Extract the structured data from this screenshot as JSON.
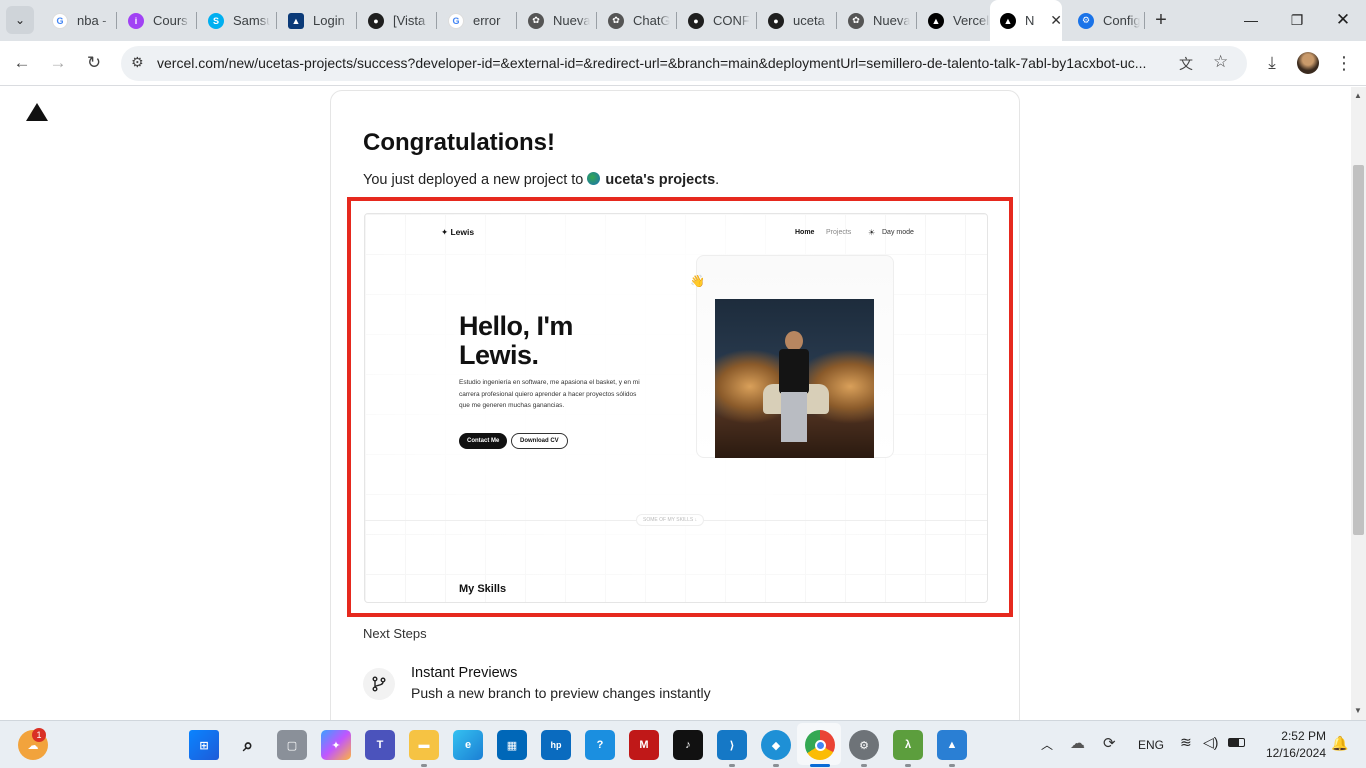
{
  "tabs": [
    {
      "title": "nba - ",
      "icon": "google-icon",
      "color": "#4285f4"
    },
    {
      "title": "Cours",
      "icon": "course-icon",
      "color": "#a142f4"
    },
    {
      "title": "Samsu",
      "icon": "skype-icon",
      "color": "#00aff0"
    },
    {
      "title": "Login",
      "icon": "atlassian-icon",
      "color": "#0b3a78"
    },
    {
      "title": "[Vista",
      "icon": "github-icon",
      "color": "#1f1f1f"
    },
    {
      "title": "error ",
      "icon": "google-icon",
      "color": "#4285f4"
    },
    {
      "title": "Nueva",
      "icon": "openai-icon",
      "color": "#555555"
    },
    {
      "title": "ChatG",
      "icon": "openai-icon",
      "color": "#555555"
    },
    {
      "title": "CONF",
      "icon": "github-icon",
      "color": "#1f1f1f"
    },
    {
      "title": "uceta",
      "icon": "github-icon",
      "color": "#1f1f1f"
    },
    {
      "title": "Nueva",
      "icon": "openai-icon",
      "color": "#555555"
    },
    {
      "title": "Vercel",
      "icon": "vercel-icon",
      "color": "#000000"
    },
    {
      "title": "N",
      "icon": "vercel-icon",
      "color": "#000000",
      "active": true
    },
    {
      "title": "Config",
      "icon": "settings-icon",
      "color": "#1a73e8"
    }
  ],
  "address_bar": {
    "url": "vercel.com/new/ucetas-projects/success?developer-id=&external-id=&redirect-url=&branch=main&deploymentUrl=semillero-de-talento-talk-7abl-by1acxbot-uc..."
  },
  "page": {
    "title": "Congratulations!",
    "subtitle_prefix": "You just deployed a new project to",
    "team_name": "uceta's projects",
    "subtitle_suffix": ".",
    "preview": {
      "brand": "✦ Lewis",
      "nav": [
        "Home",
        "Projects",
        "Day mode"
      ],
      "wave_emoji": "👋",
      "headline_1": "Hello, I'm",
      "headline_2": "Lewis.",
      "bio_1": "Estudio ingeniería en software, me apasiona el basket, y en mi",
      "bio_2": "carrera profesional quiero aprender a hacer proyectos sólidos",
      "bio_3": "que me generen muchas ganancias.",
      "contact_btn": "Contact Me",
      "cv_btn": "Download CV",
      "skills_pill": "SOME OF MY SKILLS ↓",
      "skills_heading": "My Skills"
    },
    "next_steps_label": "Next Steps",
    "steps": [
      {
        "title": "Instant Previews",
        "desc": "Push a new branch to preview changes instantly"
      }
    ]
  },
  "taskbar": {
    "lang": "ENG",
    "time": "2:52 PM",
    "date": "12/16/2024",
    "badge_count": "1"
  },
  "colors": {
    "highlight_border": "#e6291e",
    "taskbar_bg": "#e9eef3",
    "tabbar_bg": "#dfe3e7"
  }
}
